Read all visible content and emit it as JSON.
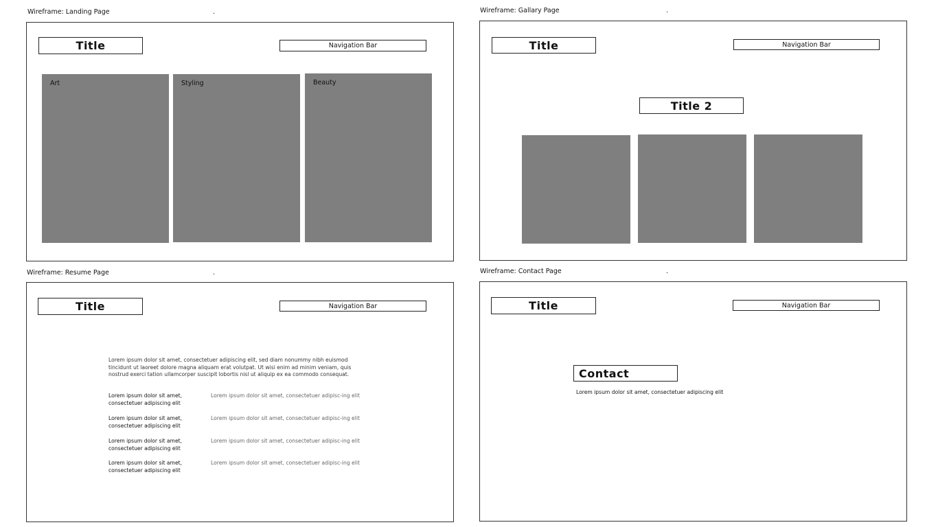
{
  "landing": {
    "label": "Wireframe: Landing Page",
    "dot": ".",
    "title": "Title",
    "nav": "Navigation Bar",
    "panels": [
      "Art",
      "Styling",
      "Beauty"
    ]
  },
  "gallery": {
    "label": "Wireframe: Gallary Page",
    "dot": ".",
    "title": "Title",
    "nav": "Navigation Bar",
    "title2": "Title 2"
  },
  "resume": {
    "label": "Wireframe: Resume Page",
    "dot": ".",
    "title": "Title",
    "nav": "Navigation Bar",
    "paragraph": "Lorem ipsum dolor sit amet, consectetuer adipiscing elit, sed diam nonummy nibh euismod tincidunt ut laoreet dolore magna aliquam erat volutpat. Ut wisi enim ad minim veniam, quis nostrud exerci tation ullamcorper suscipit lobortis nisl ut aliquip ex ea commodo consequat.",
    "rows": [
      {
        "left": "Lorem ipsum dolor sit amet, consectetuer adipiscing elit",
        "right": "Lorem ipsum dolor sit amet, consectetuer adipisc-ing elit"
      },
      {
        "left": "Lorem ipsum dolor sit amet, consectetuer adipiscing elit",
        "right": "Lorem ipsum dolor sit amet, consectetuer adipisc-ing elit"
      },
      {
        "left": "Lorem ipsum dolor sit amet, consectetuer adipiscing elit",
        "right": "Lorem ipsum dolor sit amet, consectetuer adipisc-ing elit"
      },
      {
        "left": "Lorem ipsum dolor sit amet, consectetuer adipiscing elit",
        "right": "Lorem ipsum dolor sit amet, consectetuer adipisc-ing elit"
      }
    ]
  },
  "contact": {
    "label": "Wireframe: Contact Page",
    "dot": ".",
    "title": "Title",
    "nav": "Navigation Bar",
    "heading": "Contact",
    "text": "Lorem ipsum dolor sit amet, consectetuer adipiscing elit"
  }
}
